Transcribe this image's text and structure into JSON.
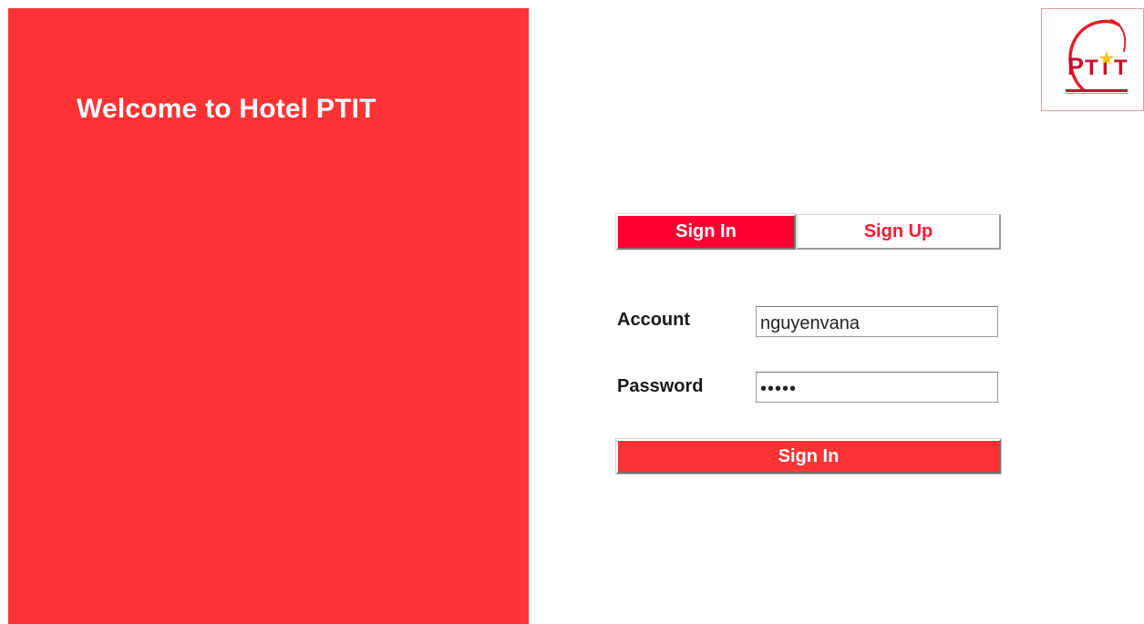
{
  "welcome": {
    "title": "Welcome to Hotel PTIT"
  },
  "logo": {
    "text": "PTIT",
    "letter_p": "P",
    "letter_t1": "T",
    "letter_i": "I",
    "letter_t2": "T",
    "ring_color": "#e0202a",
    "text_color": "#c8102e",
    "star_color": "#f2c200"
  },
  "tabs": {
    "signin_label": "Sign In",
    "signup_label": "Sign Up"
  },
  "form": {
    "account_label": "Account",
    "account_value": "nguyenvana",
    "password_label": "Password",
    "password_mask": "•••••",
    "submit_label": "Sign In"
  },
  "colors": {
    "panel": "#ff3333",
    "active_tab": "#ff0033",
    "tab_text_inactive": "#ff1a33",
    "white": "#ffffff"
  }
}
